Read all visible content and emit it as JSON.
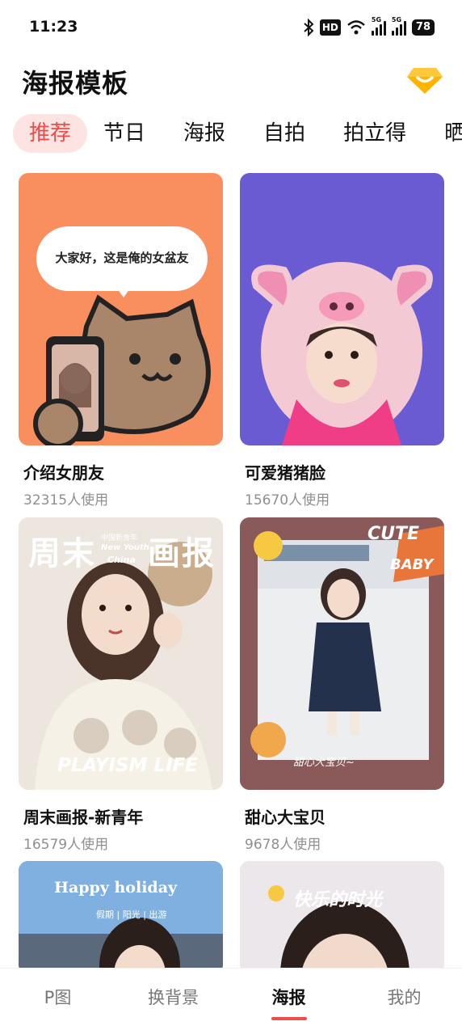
{
  "status_bar": {
    "time": "11:23",
    "hd_label": "HD",
    "network_1": "5G",
    "network_2": "5G",
    "battery": "78",
    "icons": [
      "bluetooth-icon",
      "hd-icon",
      "wifi-icon",
      "signal-icon",
      "signal-icon",
      "battery-icon"
    ]
  },
  "header": {
    "title": "海报模板",
    "vip_icon": "diamond-vip-icon",
    "accent_color": "#ef4b48"
  },
  "tabs": [
    {
      "label": "推荐",
      "active": true
    },
    {
      "label": "节日",
      "active": false
    },
    {
      "label": "海报",
      "active": false
    },
    {
      "label": "自拍",
      "active": false
    },
    {
      "label": "拍立得",
      "active": false
    },
    {
      "label": "晒娃",
      "active": false
    }
  ],
  "templates": [
    {
      "title": "介绍女朋友",
      "usage": "32315人使用",
      "thumb_text": [
        "大家好，这是俺的女盆友"
      ],
      "bg": "#f98e5e"
    },
    {
      "title": "可爱猪猪脸",
      "usage": "15670人使用",
      "thumb_text": [],
      "bg": "#6a5bd3"
    },
    {
      "title": "周末画报-新青年",
      "usage": "16579人使用",
      "thumb_text": [
        "周末",
        "画报",
        "中国新青年",
        "New Youth",
        "China",
        "PLAYISM LIFE"
      ],
      "bg": "#e9e2d9"
    },
    {
      "title": "甜心大宝贝",
      "usage": "9678人使用",
      "thumb_text": [
        "CUTE",
        "BABY",
        "甜心大宝贝~"
      ],
      "bg": "#8a5a5a"
    },
    {
      "title": "",
      "usage": "",
      "thumb_text": [
        "Happy holiday",
        "假期 | 阳光 | 出游"
      ],
      "bg": "#6f9fd6"
    },
    {
      "title": "",
      "usage": "",
      "thumb_text": [
        "快乐的时光"
      ],
      "bg": "#e8e3e6"
    }
  ],
  "bottom_nav": [
    {
      "label": "P图",
      "active": false
    },
    {
      "label": "换背景",
      "active": false
    },
    {
      "label": "海报",
      "active": true
    },
    {
      "label": "我的",
      "active": false
    }
  ]
}
